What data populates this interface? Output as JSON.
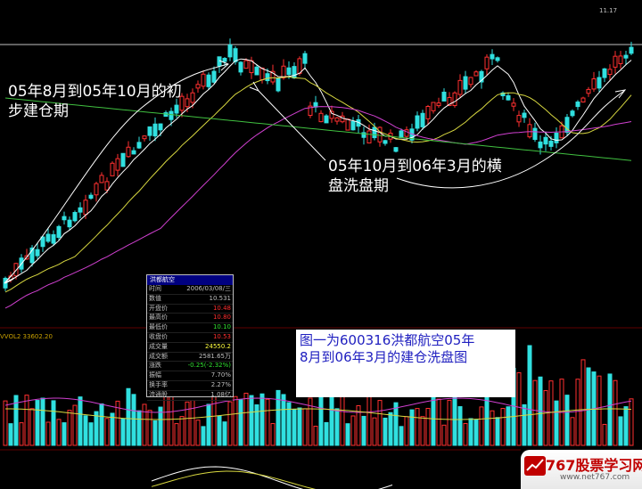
{
  "chart_data": [
    {
      "type": "candlestick",
      "title": "",
      "reference_price_label": "11.17",
      "candles": [],
      "moving_averages": [
        {
          "name": "",
          "color": "#ffffff"
        },
        {
          "name": "",
          "color": "#d8d840"
        },
        {
          "name": "",
          "color": "#d040d0"
        },
        {
          "name": "",
          "color": "#40c040"
        }
      ],
      "grid": false
    },
    {
      "type": "bar",
      "title": "",
      "indicator_label": "VVOL2 33602.20",
      "values": [],
      "colors": {
        "up": "#ff3030",
        "down": "#30d0d0"
      }
    }
  ],
  "colors": {
    "background": "#000000",
    "up": "#ff3030",
    "down": "#30e0e0",
    "annotation": "#ffffff",
    "caption_text": "#2020c0",
    "watermark": "#c00000"
  },
  "annotations": {
    "period1_line1": "05年8月到05年10月的初",
    "period1_line2": "步建仓期",
    "period2_line1": "05年10月到06年3月的横",
    "period2_line2": "盘洗盘期"
  },
  "caption": {
    "line1": "图一为600316洪都航空05年",
    "line2": "8月到06年3月的建仓洗盘图"
  },
  "info_panel": {
    "title": "洪都航空",
    "rows": [
      {
        "label": "时间",
        "value": "2006/03/08/三",
        "color": "#c0c0c0"
      },
      {
        "label": "数值",
        "value": "10.531",
        "color": "#c0c0c0"
      },
      {
        "label": "开盘价",
        "value": "10.48",
        "color": "#ff3030"
      },
      {
        "label": "最高价",
        "value": "10.80",
        "color": "#ff3030"
      },
      {
        "label": "最低价",
        "value": "10.10",
        "color": "#30e030"
      },
      {
        "label": "收盘价",
        "value": "10.53",
        "color": "#ff3030"
      },
      {
        "label": "成交量",
        "value": "24550.2",
        "color": "#ffff40"
      },
      {
        "label": "成交额",
        "value": "2581.65万",
        "color": "#c0c0c0"
      },
      {
        "label": "涨跌",
        "value": "-0.25(-2.32%)",
        "color": "#30e030"
      },
      {
        "label": "振幅",
        "value": "7.70%",
        "color": "#c0c0c0"
      },
      {
        "label": "换手率",
        "value": "2.27%",
        "color": "#c0c0c0"
      },
      {
        "label": "流通股",
        "value": "1.08亿",
        "color": "#c0c0c0"
      }
    ]
  },
  "watermark": {
    "title": "767股票学习网",
    "url": "www.net767.com"
  }
}
